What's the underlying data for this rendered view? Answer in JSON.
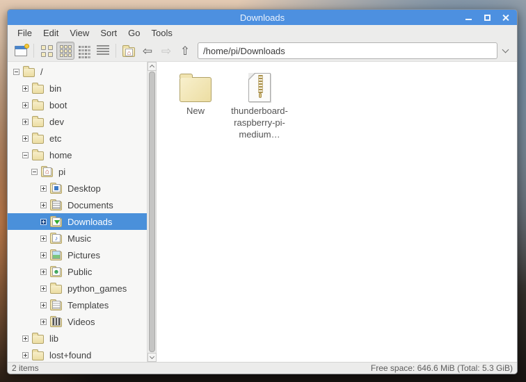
{
  "window": {
    "title": "Downloads"
  },
  "menubar": {
    "items": [
      "File",
      "Edit",
      "View",
      "Sort",
      "Go",
      "Tools"
    ]
  },
  "toolbar": {
    "path_value": "/home/pi/Downloads"
  },
  "sidebar": {
    "tree": [
      {
        "label": "/",
        "level": 0,
        "expander": "minus",
        "icon": "folder"
      },
      {
        "label": "bin",
        "level": 1,
        "expander": "plus",
        "icon": "folder"
      },
      {
        "label": "boot",
        "level": 1,
        "expander": "plus",
        "icon": "folder"
      },
      {
        "label": "dev",
        "level": 1,
        "expander": "plus",
        "icon": "folder"
      },
      {
        "label": "etc",
        "level": 1,
        "expander": "plus",
        "icon": "folder"
      },
      {
        "label": "home",
        "level": 1,
        "expander": "minus",
        "icon": "folder"
      },
      {
        "label": "pi",
        "level": 2,
        "expander": "minus",
        "icon": "folder-home"
      },
      {
        "label": "Desktop",
        "level": 3,
        "expander": "plus",
        "icon": "folder-desktop"
      },
      {
        "label": "Documents",
        "level": 3,
        "expander": "plus",
        "icon": "folder-documents"
      },
      {
        "label": "Downloads",
        "level": 3,
        "expander": "plus",
        "icon": "folder-downloads",
        "selected": true
      },
      {
        "label": "Music",
        "level": 3,
        "expander": "plus",
        "icon": "folder-music"
      },
      {
        "label": "Pictures",
        "level": 3,
        "expander": "plus",
        "icon": "folder-pictures"
      },
      {
        "label": "Public",
        "level": 3,
        "expander": "plus",
        "icon": "folder-public"
      },
      {
        "label": "python_games",
        "level": 3,
        "expander": "plus",
        "icon": "folder"
      },
      {
        "label": "Templates",
        "level": 3,
        "expander": "plus",
        "icon": "folder-templates"
      },
      {
        "label": "Videos",
        "level": 3,
        "expander": "plus",
        "icon": "folder-videos"
      },
      {
        "label": "lib",
        "level": 1,
        "expander": "plus",
        "icon": "folder"
      },
      {
        "label": "lost+found",
        "level": 1,
        "expander": "plus",
        "icon": "folder"
      }
    ]
  },
  "files": {
    "items": [
      {
        "name": "New",
        "icon": "folder"
      },
      {
        "name": "thunderboard-raspberry-pi-medium…",
        "icon": "zip-archive"
      }
    ]
  },
  "statusbar": {
    "left": "2 items",
    "right": "Free space: 646.6 MiB (Total: 5.3 GiB)"
  },
  "icons": {
    "titlebar": [
      "minimize-icon",
      "maximize-icon",
      "close-icon"
    ],
    "toolbar": [
      "new-window-icon",
      "icon-view-icon",
      "thumbnail-view-icon",
      "compact-view-icon",
      "detailed-list-icon",
      "home-icon",
      "back-icon",
      "forward-icon",
      "up-icon",
      "path-dropdown-icon"
    ],
    "music_glyph": "♪",
    "public_glyph": "☻",
    "home_glyph": "⌂",
    "back_glyph": "⇦",
    "forward_glyph": "⇨",
    "up_glyph": "⇧"
  },
  "colors": {
    "titlebar_blue": "#4d90e0",
    "selection_blue": "#4a90da",
    "folder_yellow": "#eedfa6",
    "window_gray": "#ececeb"
  },
  "state": {
    "active_view": "thumbnail-view",
    "forward_disabled": true
  }
}
